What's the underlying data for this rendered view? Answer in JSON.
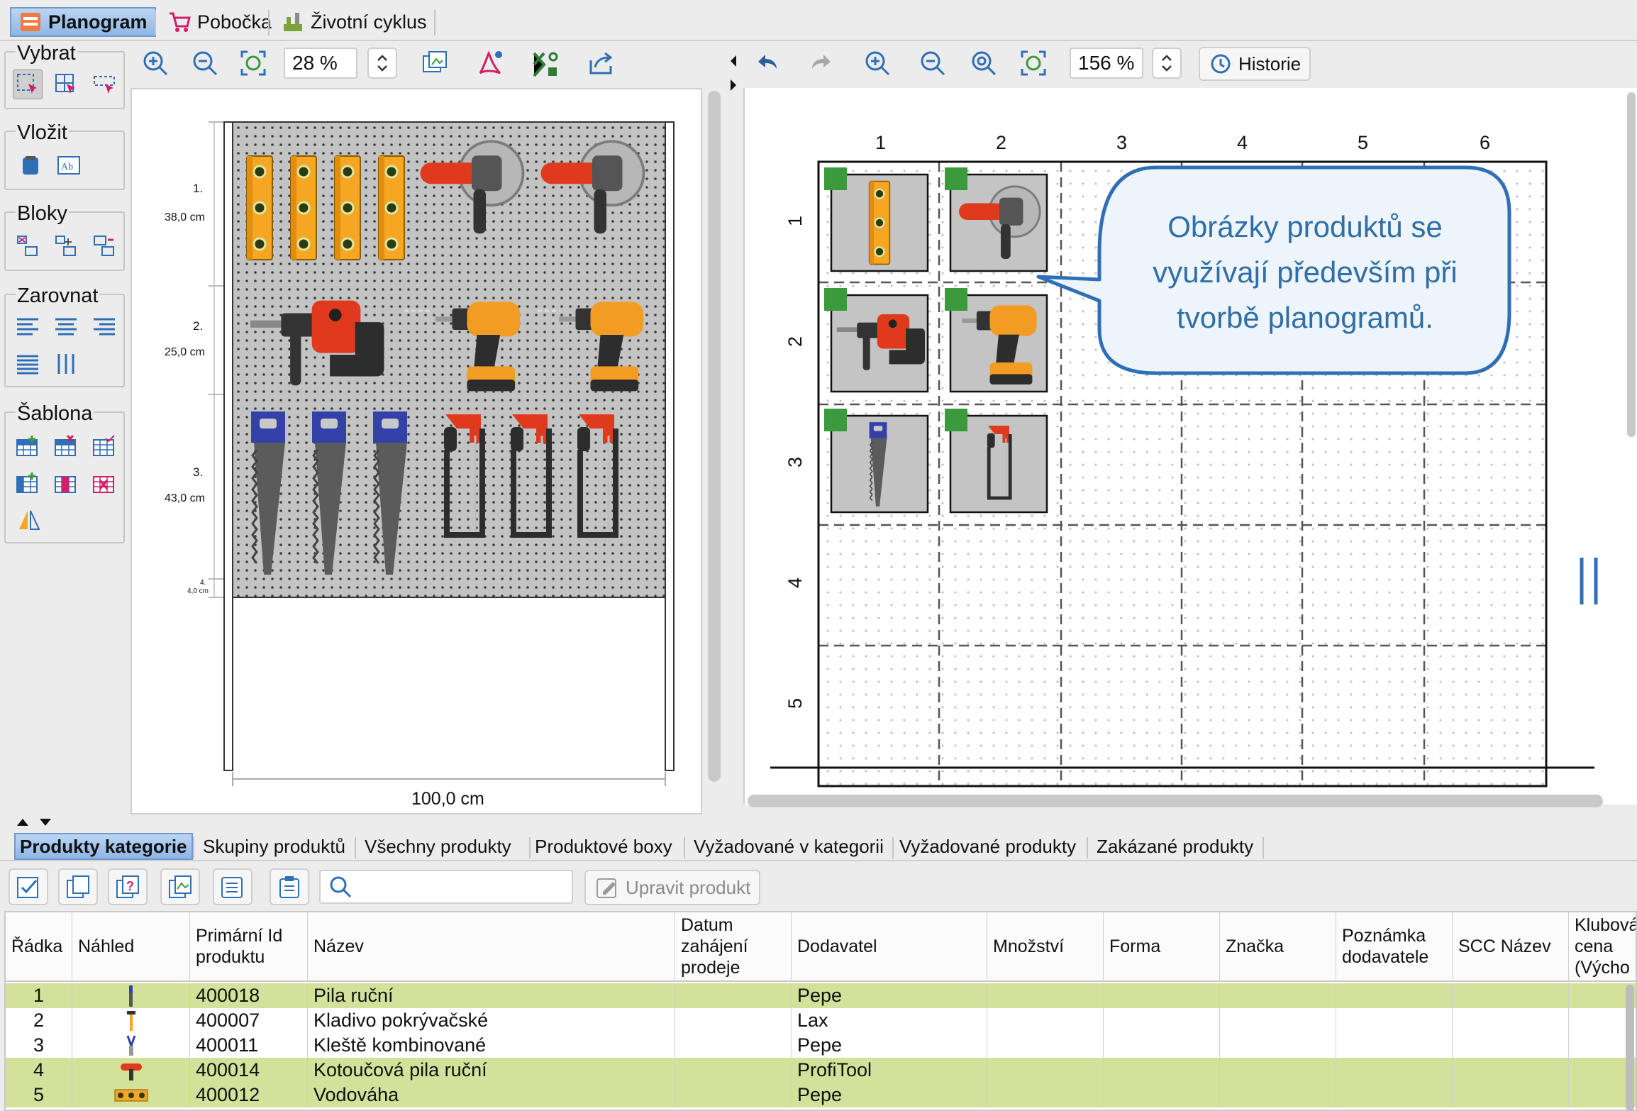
{
  "top_tabs": [
    {
      "label": "Planogram",
      "icon": "planogram-icon",
      "active": true
    },
    {
      "label": "Pobočka",
      "icon": "cart-icon",
      "active": false
    },
    {
      "label": "Životní cyklus",
      "icon": "lifecycle-icon",
      "active": false
    }
  ],
  "palette": {
    "vybrat": "Vybrat",
    "vlozit": "Vložit",
    "bloky": "Bloky",
    "zarovnat": "Zarovnat",
    "sablona": "Šablona"
  },
  "left_toolbar": {
    "zoom": "28 %"
  },
  "right_toolbar": {
    "zoom": "156 %",
    "history_label": "Historie"
  },
  "planogram": {
    "shelves": [
      {
        "label": "1.",
        "height": "38,0 cm"
      },
      {
        "label": "2.",
        "height": "25,0 cm"
      },
      {
        "label": "3.",
        "height": "43,0 cm"
      },
      {
        "label": "4.",
        "height": "4,0 cm"
      }
    ],
    "width_label": "100,0 cm"
  },
  "grid": {
    "columns": [
      "1",
      "2",
      "3",
      "4",
      "5",
      "6"
    ],
    "rows": [
      "1",
      "2",
      "3",
      "4",
      "5"
    ]
  },
  "callout": "Obrázky produktů se využívají především při tvorbě planogramů.",
  "bottom_tabs": [
    {
      "label": "Produkty kategorie",
      "active": true
    },
    {
      "label": "Skupiny produktů"
    },
    {
      "label": "Všechny produkty"
    },
    {
      "label": "Produktové boxy"
    },
    {
      "label": "Vyžadované v kategorii"
    },
    {
      "label": "Vyžadované produkty"
    },
    {
      "label": "Zakázané produkty"
    }
  ],
  "bottom_toolbar": {
    "search_placeholder": "",
    "edit_label": "Upravit produkt"
  },
  "table": {
    "headers": [
      "Řádka",
      "Náhled",
      "Primární Id produktu",
      "Název",
      "Datum zahájení prodeje",
      "Dodavatel",
      "Množství",
      "Forma",
      "Značka",
      "Poznámka dodavatele",
      "SCC Název",
      "Klubová cena (Výcho"
    ],
    "rows": [
      {
        "n": "1",
        "id": "400018",
        "name": "Pila ruční",
        "supplier": "Pepe",
        "highlight": true,
        "thumb": "saw"
      },
      {
        "n": "2",
        "id": "400007",
        "name": "Kladivo pokrývačské",
        "supplier": "Lax",
        "highlight": false,
        "thumb": "hammer"
      },
      {
        "n": "3",
        "id": "400011",
        "name": "Kleště kombinované",
        "supplier": "Pepe",
        "highlight": false,
        "thumb": "pliers"
      },
      {
        "n": "4",
        "id": "400014",
        "name": "Kotoučová pila ruční",
        "supplier": "ProfiTool",
        "highlight": true,
        "thumb": "circular-saw"
      },
      {
        "n": "5",
        "id": "400012",
        "name": "Vodováha",
        "supplier": "Pepe",
        "highlight": true,
        "thumb": "level"
      }
    ]
  },
  "colors": {
    "accent_tab": "#8fb6e6",
    "row_highlight": "#d3e19a",
    "callout_text": "#2f6fa6",
    "product_marker": "#3b9a3b"
  }
}
